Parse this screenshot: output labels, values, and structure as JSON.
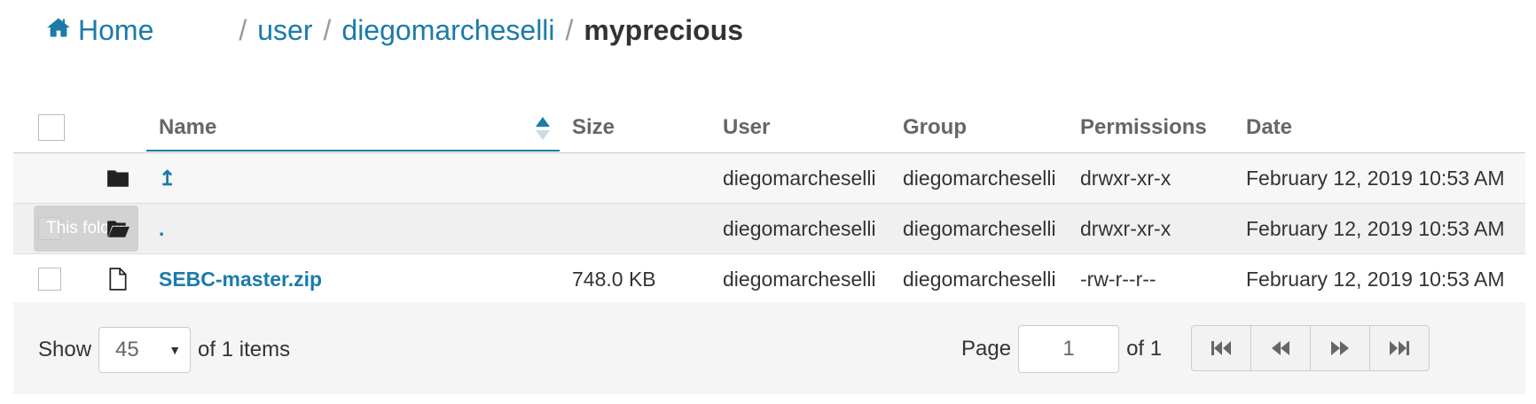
{
  "breadcrumb": {
    "home_label": "Home",
    "separator": "/",
    "items": [
      "user",
      "diegomarcheselli"
    ],
    "current": "myprecious"
  },
  "table": {
    "columns": {
      "name": "Name",
      "size": "Size",
      "user": "User",
      "group": "Group",
      "permissions": "Permissions",
      "date": "Date"
    },
    "rows": [
      {
        "icon": "folder-icon",
        "name": "↥",
        "size": "",
        "user": "diegomarcheselli",
        "group": "diegomarcheselli",
        "permissions": "drwxr-xr-x",
        "date": "February 12, 2019 10:53 AM"
      },
      {
        "icon": "folder-open-icon",
        "name": ".",
        "size": "",
        "user": "diegomarcheselli",
        "group": "diegomarcheselli",
        "permissions": "drwxr-xr-x",
        "date": "February 12, 2019 10:53 AM",
        "tooltip": "This folder"
      },
      {
        "icon": "file-icon",
        "name": "SEBC-master.zip",
        "size": "748.0 KB",
        "user": "diegomarcheselli",
        "group": "diegomarcheselli",
        "permissions": "-rw-r--r--",
        "date": "February 12, 2019 10:53 AM"
      }
    ]
  },
  "footer": {
    "show_label": "Show",
    "page_size": "45",
    "items_label": "of 1 items",
    "page_label": "Page",
    "page_value": "1",
    "of_pages": "of 1"
  },
  "colors": {
    "link": "#1b7ba9"
  }
}
